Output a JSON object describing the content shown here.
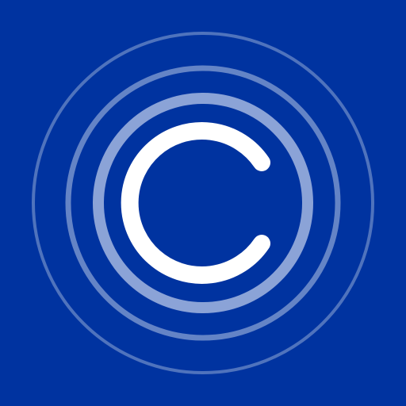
{
  "app_icon": {
    "icon_name": "copyright-c-ripple-icon",
    "colors": {
      "background": "#0033A0",
      "rings": "#8FA7D6",
      "letter": "#FFFFFF"
    }
  }
}
